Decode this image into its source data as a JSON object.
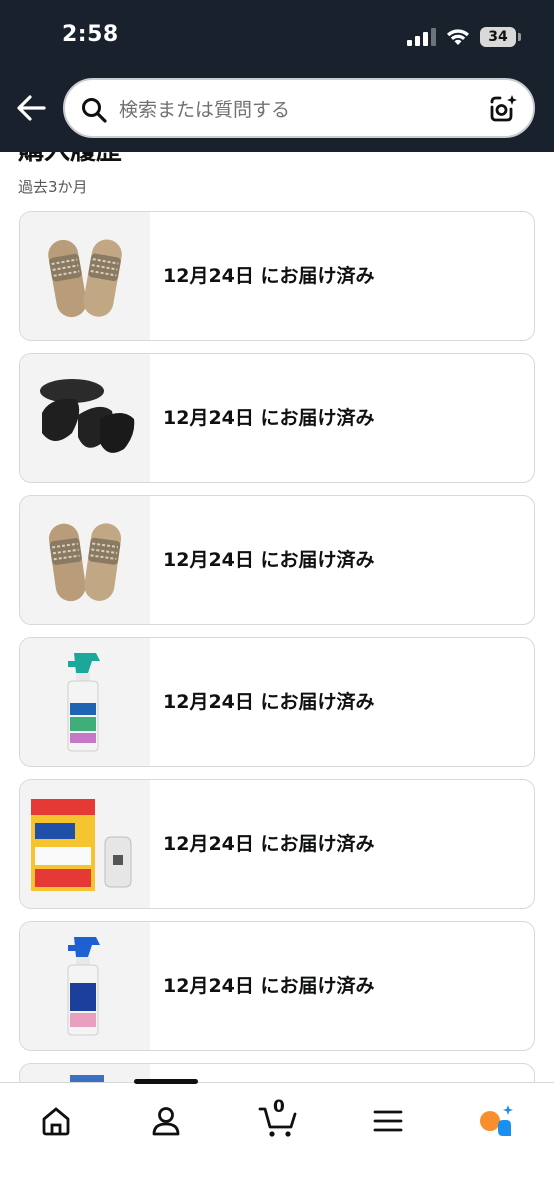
{
  "status_bar": {
    "time": "2:58",
    "battery": "34"
  },
  "search": {
    "placeholder": "検索または質問する",
    "icons": [
      "back-arrow-icon",
      "search-icon",
      "camera-lens-icon"
    ]
  },
  "section": {
    "title": "購入履歴",
    "subtitle": "過去3か月"
  },
  "orders": [
    {
      "status": "12月24日 にお届け済み",
      "thumbnail": "woven-slippers"
    },
    {
      "status": "12月24日 にお届け済み",
      "thumbnail": "black-slippers"
    },
    {
      "status": "12月24日 にお届け済み",
      "thumbnail": "woven-slippers"
    },
    {
      "status": "12月24日 にお届け済み",
      "thumbnail": "kitchen-haiter-spray"
    },
    {
      "status": "12月24日 にお届け済み",
      "thumbnail": "drain-cleaner-pack"
    },
    {
      "status": "12月24日 にお届け済み",
      "thumbnail": "kabi-haiter-spray"
    }
  ],
  "tabbar": {
    "cart_count": "0",
    "tabs": [
      "home-icon",
      "account-icon",
      "cart-icon",
      "menu-icon",
      "rufus-icon"
    ],
    "colors": {
      "accent_orange": "#f78f2c",
      "accent_blue": "#1a8ff0"
    }
  },
  "colors": {
    "header_bg": "#18212c",
    "card_border": "#d5d9d9",
    "thumb_bg": "#f3f3f3"
  }
}
